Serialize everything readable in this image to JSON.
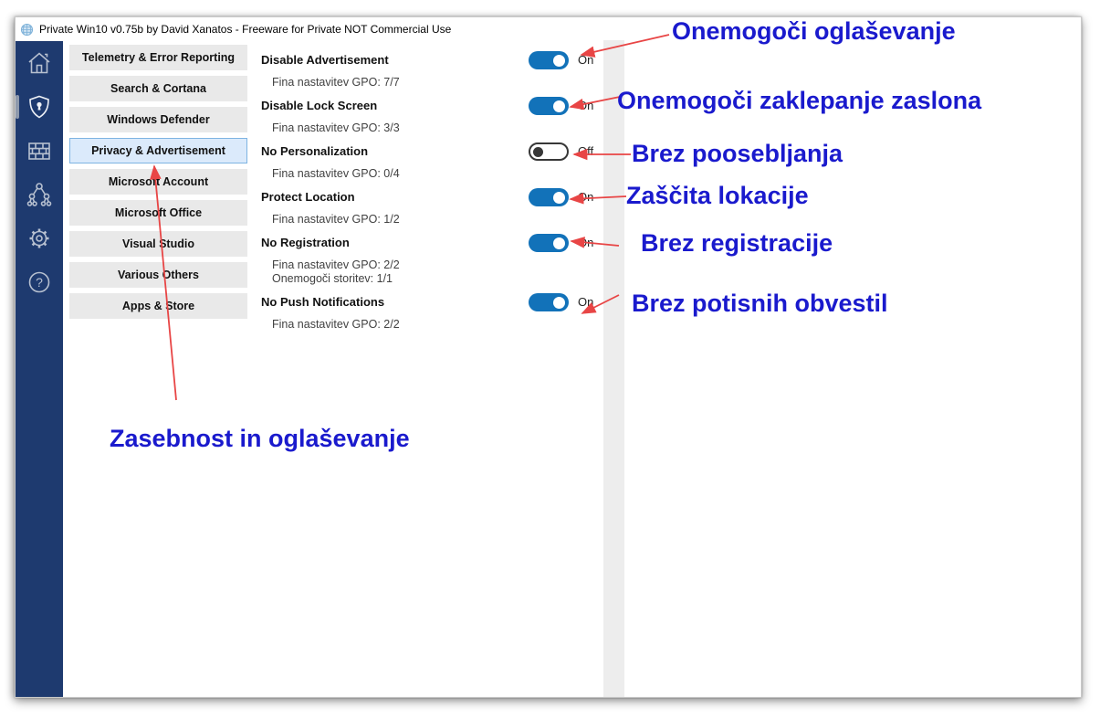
{
  "window": {
    "title": "Private Win10 v0.75b by David Xanatos - Freeware for Private NOT Commercial Use"
  },
  "sidebar": {
    "items": [
      {
        "icon": "home-icon",
        "selected": false
      },
      {
        "icon": "shield-icon",
        "selected": true
      },
      {
        "icon": "firewall-icon",
        "selected": false
      },
      {
        "icon": "network-tree-icon",
        "selected": false
      },
      {
        "icon": "gear-icon",
        "selected": false
      },
      {
        "icon": "help-icon",
        "selected": false
      }
    ]
  },
  "categories": {
    "items": [
      {
        "label": "Telemetry & Error Reporting",
        "selected": false
      },
      {
        "label": "Search & Cortana",
        "selected": false
      },
      {
        "label": "Windows Defender",
        "selected": false
      },
      {
        "label": "Privacy & Advertisement",
        "selected": true
      },
      {
        "label": "Microsoft Account",
        "selected": false
      },
      {
        "label": "Microsoft Office",
        "selected": false
      },
      {
        "label": "Visual Studio",
        "selected": false
      },
      {
        "label": "Various Others",
        "selected": false
      },
      {
        "label": "Apps & Store",
        "selected": false
      }
    ]
  },
  "settings": {
    "items": [
      {
        "name": "Disable Advertisement",
        "details": [
          "Fina nastavitev GPO: 7/7"
        ],
        "toggle": "On"
      },
      {
        "name": "Disable Lock Screen",
        "details": [
          "Fina nastavitev GPO: 3/3"
        ],
        "toggle": "On"
      },
      {
        "name": "No Personalization",
        "details": [
          "Fina nastavitev GPO: 0/4"
        ],
        "toggle": "Off"
      },
      {
        "name": "Protect Location",
        "details": [
          "Fina nastavitev GPO: 1/2"
        ],
        "toggle": "On"
      },
      {
        "name": "No Registration",
        "details": [
          "Fina nastavitev GPO: 2/2",
          "Onemogoči storitev: 1/1"
        ],
        "toggle": "On"
      },
      {
        "name": "No Push Notifications",
        "details": [
          "Fina nastavitev GPO: 2/2"
        ],
        "toggle": "On"
      }
    ]
  },
  "annotations": {
    "labels": [
      {
        "text": "Onemogoči oglaševanje"
      },
      {
        "text": "Onemogoči zaklepanje zaslona"
      },
      {
        "text": "Brez poosebljanja"
      },
      {
        "text": "Zaščita lokacije"
      },
      {
        "text": "Brez registracije"
      },
      {
        "text": "Brez potisnih obvestil"
      },
      {
        "text": "Zasebnost in oglaševanje"
      }
    ]
  },
  "colors": {
    "sidebar_navy": "#1e3a6f",
    "toggle_on_blue": "#1272b9",
    "annotation_blue": "#1a1acd",
    "arrow_red": "#e84545",
    "selected_tab_bg": "#dbeafb",
    "selected_tab_border": "#7eb4e2",
    "scroll_strip": "#ededed"
  }
}
